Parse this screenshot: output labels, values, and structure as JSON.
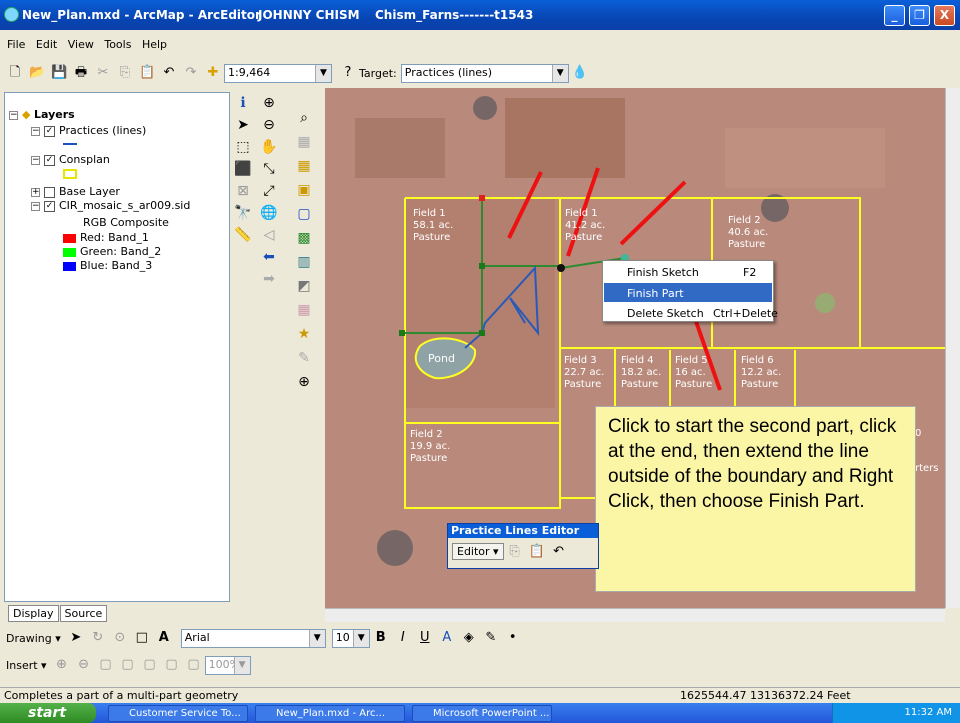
{
  "window": {
    "title": "New_Plan.mxd - ArcMap - ArcEditor",
    "user": "JOHNNY CHISM",
    "farm": "Chism_Farns-------t1543",
    "min": "_",
    "max": "❐",
    "close": "X"
  },
  "menu": [
    "File",
    "Edit",
    "View",
    "Tools",
    "Help"
  ],
  "standard_toolbar": {
    "scale": "1:9,464",
    "target_label": "Target:",
    "target_value": "Practices (lines)"
  },
  "toc": {
    "root": "Layers",
    "layers": [
      {
        "label": "Practices (lines)",
        "checked": true
      },
      {
        "label": "Consplan",
        "checked": true
      },
      {
        "label": "Base Layer",
        "checked": false
      },
      {
        "label": "CIR_mosaic_s_ar009.sid",
        "checked": true
      }
    ],
    "rgb_label": "RGB Composite",
    "bands": [
      {
        "label": "Red:   Band_1",
        "color": "#ff0000"
      },
      {
        "label": "Green: Band_2",
        "color": "#00ff00"
      },
      {
        "label": "Blue:  Band_3",
        "color": "#0000ff"
      }
    ],
    "tabs": [
      "Display",
      "Source"
    ]
  },
  "map": {
    "fields": [
      {
        "name": "Field 1",
        "area": "58.1 ac.",
        "use": "Pasture"
      },
      {
        "name": "Field 1",
        "area": "41.2 ac.",
        "use": "Pasture"
      },
      {
        "name": "Field 2",
        "area": "40.6 ac.",
        "use": "Pasture"
      },
      {
        "name": "Field 3",
        "area": "22.7 ac.",
        "use": "Pasture"
      },
      {
        "name": "Field 4",
        "area": "18.2 ac.",
        "use": "Pasture"
      },
      {
        "name": "Field 5",
        "area": "16 ac.",
        "use": "Pasture"
      },
      {
        "name": "Field 6",
        "area": "12.2 ac.",
        "use": "Pasture"
      },
      {
        "name": "Field 2",
        "area": "19.9 ac.",
        "use": "Pasture"
      }
    ],
    "pond": "Pond",
    "edge_text": "rters",
    "edge_text2": "0"
  },
  "context_menu": {
    "items": [
      {
        "label": "Finish Sketch",
        "shortcut": "F2"
      },
      {
        "label": "Finish Part",
        "shortcut": ""
      },
      {
        "label": "Delete Sketch",
        "shortcut": "Ctrl+Delete"
      }
    ]
  },
  "callout": "Click to start the second part, click at the end, then extend the line outside of the boundary and Right Click, then choose Finish Part.",
  "editor": {
    "title": "Practice Lines Editor",
    "button": "Editor ▾"
  },
  "drawing_toolbar": {
    "drawing": "Drawing ▾",
    "font": "Arial",
    "size": "10"
  },
  "insert_toolbar": {
    "insert": "Insert ▾",
    "zoom": "100%"
  },
  "status": {
    "message": "Completes a part of a multi-part geometry",
    "coords": "1625544.47  13136372.24 Feet"
  },
  "taskbar": {
    "start": "start",
    "tasks": [
      "Customer Service To...",
      "New_Plan.mxd - Arc...",
      "Microsoft PowerPoint ..."
    ],
    "time": "11:32 AM"
  }
}
